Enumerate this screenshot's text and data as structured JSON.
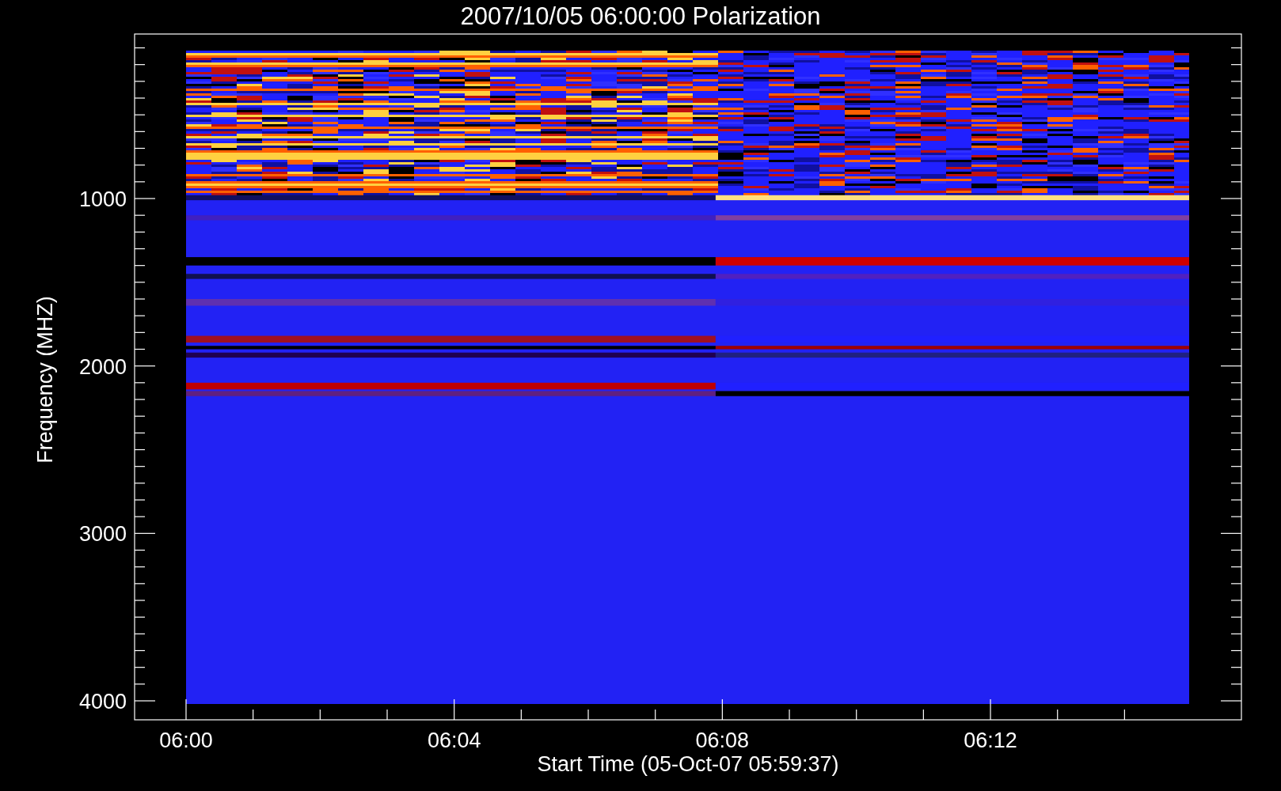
{
  "title": "2007/10/05 06:00:00 Polarization",
  "x_axis": {
    "label": "Start Time (05-Oct-07 05:59:37)",
    "ticks": [
      "06:00",
      "06:04",
      "06:08",
      "06:12"
    ]
  },
  "y_axis": {
    "label": "Frequency (MHZ)",
    "ticks": [
      "1000",
      "2000",
      "3000",
      "4000"
    ]
  }
}
